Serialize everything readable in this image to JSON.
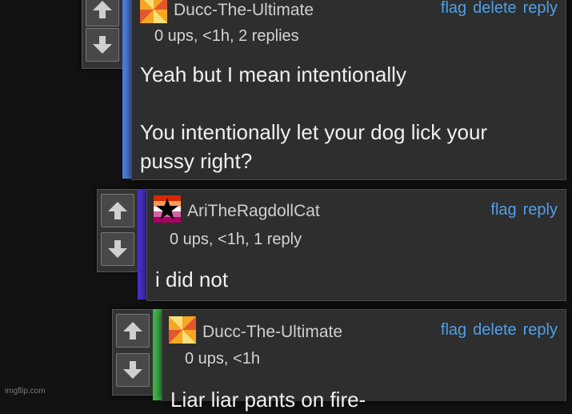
{
  "comments": [
    {
      "username": "Ducc-The-Ultimate",
      "meta": "0 ups, <1h, 2 replies",
      "body_lines": [
        "Yeah but I mean intentionally",
        "",
        "You intentionally let your dog lick your",
        "pussy right?"
      ],
      "actions": [
        "flag",
        "delete",
        "reply"
      ],
      "thread_color": "#4f7fe0",
      "avatar_icon": "orange-pinwheel-avatar"
    },
    {
      "username": "AriTheRagdollCat",
      "meta": "0 ups, <1h, 1 reply",
      "body_lines": [
        "i did not"
      ],
      "actions": [
        "flag",
        "reply"
      ],
      "thread_color": "#4a2fd0",
      "avatar_icon": "star-flag-avatar"
    },
    {
      "username": "Ducc-The-Ultimate",
      "meta": "0 ups, <1h",
      "body_lines": [
        "Liar liar pants on fire-"
      ],
      "actions": [
        "flag",
        "delete",
        "reply"
      ],
      "thread_color": "#3fb84a",
      "avatar_icon": "orange-pinwheel-avatar"
    }
  ],
  "icons": {
    "upvote": "arrow-up-icon",
    "downvote": "arrow-down-icon"
  },
  "watermark": "imgflip.com"
}
